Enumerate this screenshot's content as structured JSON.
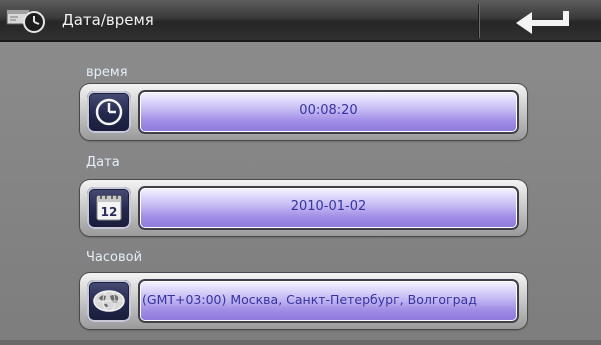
{
  "header": {
    "title": "Дата/время",
    "icons": {
      "settings": "settings-clock-icon",
      "back": "back-arrow-icon"
    }
  },
  "time": {
    "label": "время",
    "value": "00:08:20",
    "icon": "clock-icon"
  },
  "date": {
    "label": "Дата",
    "value": "2010-01-02",
    "icon": "calendar-icon",
    "icon_day": "12"
  },
  "timezone": {
    "label": "Часовой",
    "value": "(GMT+03:00) Москва, Санкт-Петербург, Волгоград",
    "icon": "globe-icon"
  },
  "colors": {
    "field_text": "#3535a0",
    "field_fill": "#a18ee6",
    "icon_bg": "#24284d",
    "label_text": "#e6eef8"
  }
}
